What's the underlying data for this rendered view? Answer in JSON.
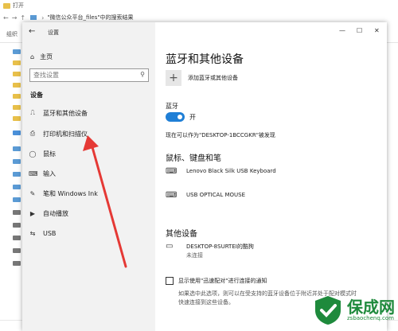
{
  "explorer": {
    "title": "打开",
    "address": "\"微信公众平台_files\"中的搜索结果",
    "toolbar_label": "组织"
  },
  "settings": {
    "window_title": "设置",
    "controls": {
      "minimize": "—",
      "maximize": "☐",
      "close": "✕"
    },
    "sidebar": {
      "home": "主页",
      "search_placeholder": "查找设置",
      "section": "设备",
      "items": [
        {
          "label": "蓝牙和其他设备",
          "icon": "⎍"
        },
        {
          "label": "打印机和扫描仪",
          "icon": "⎙"
        },
        {
          "label": "鼠标",
          "icon": "◯"
        },
        {
          "label": "输入",
          "icon": "⌨"
        },
        {
          "label": "笔和 Windows Ink",
          "icon": "✎"
        },
        {
          "label": "自动播放",
          "icon": "▶"
        },
        {
          "label": "USB",
          "icon": "⇆"
        }
      ]
    },
    "main": {
      "title": "蓝牙和其他设备",
      "add_label": "添加蓝牙或其他设备",
      "bluetooth_label": "蓝牙",
      "bluetooth_state": "开",
      "discoverable": "现在可以作为\"DESKTOP-1BCCGKR\"被发现",
      "mouse_section": "鼠标、键盘和笔",
      "devices": [
        {
          "name": "Lenovo Black Silk USB Keyboard",
          "sub": ""
        },
        {
          "name": "USB OPTICAL MOUSE",
          "sub": ""
        }
      ],
      "other_section": "其他设备",
      "other_devices": [
        {
          "name": "DESKTOP-8SURTEI的酷狗",
          "sub": "未连接"
        }
      ],
      "swift_pair_label": "显示使用\"迅速配对\"进行连接的通知",
      "swift_pair_note": "如果选中此选项，则可以在受支持的蓝牙设备位于附近并处于配对模式时快速连接到这些设备。"
    }
  },
  "watermark": {
    "text": "保成网",
    "url": "zsbaochenq.com",
    "color": "#1e8a3c"
  },
  "colors": {
    "accent": "#1f7fd6",
    "arrow": "#e53935"
  }
}
